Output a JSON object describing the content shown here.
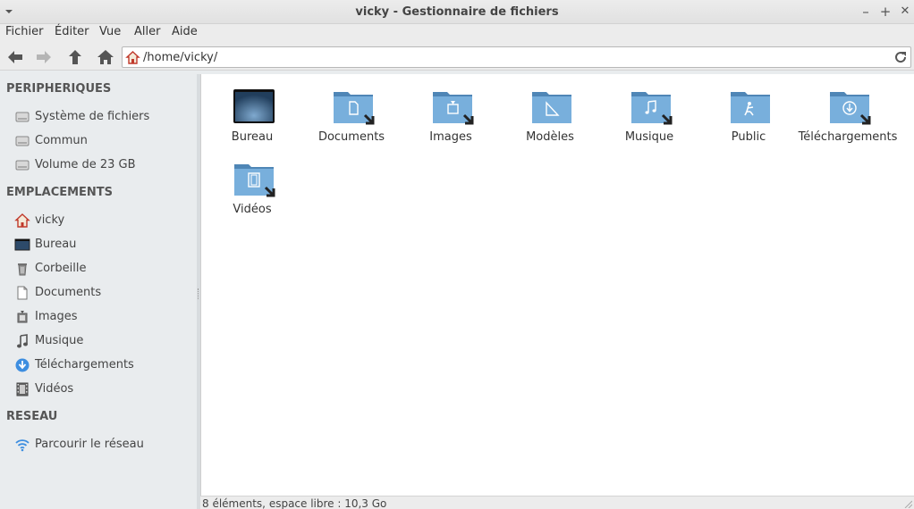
{
  "window": {
    "title": "vicky - Gestionnaire de fichiers",
    "minimize": "–",
    "maximize": "+",
    "close": "✕"
  },
  "menubar": [
    "Fichier",
    "Éditer",
    "Vue",
    "Aller",
    "Aide"
  ],
  "toolbar": {
    "icons": [
      "back-arrow-icon",
      "forward-arrow-icon",
      "up-arrow-icon",
      "home-icon"
    ],
    "location": "/home/vicky/"
  },
  "sidebar": {
    "devices_title": "PERIPHERIQUES",
    "devices": [
      {
        "label": "Système de fichiers",
        "icon": "drive-icon"
      },
      {
        "label": "Commun",
        "icon": "drive-icon"
      },
      {
        "label": "Volume de 23 GB",
        "icon": "drive-icon"
      }
    ],
    "places_title": "EMPLACEMENTS",
    "places": [
      {
        "label": "vicky",
        "icon": "home-icon"
      },
      {
        "label": "Bureau",
        "icon": "desktop-icon"
      },
      {
        "label": "Corbeille",
        "icon": "trash-icon"
      },
      {
        "label": "Documents",
        "icon": "document-icon"
      },
      {
        "label": "Images",
        "icon": "image-icon"
      },
      {
        "label": "Musique",
        "icon": "music-icon"
      },
      {
        "label": "Téléchargements",
        "icon": "download-icon"
      },
      {
        "label": "Vidéos",
        "icon": "video-icon"
      }
    ],
    "network_title": "RESEAU",
    "network": [
      {
        "label": "Parcourir le réseau",
        "icon": "wifi-icon"
      }
    ]
  },
  "files": [
    {
      "label": "Bureau",
      "icon": "desktop-folder-icon"
    },
    {
      "label": "Documents",
      "icon": "documents-folder-icon"
    },
    {
      "label": "Images",
      "icon": "images-folder-icon"
    },
    {
      "label": "Modèles",
      "icon": "templates-folder-icon"
    },
    {
      "label": "Musique",
      "icon": "music-folder-icon"
    },
    {
      "label": "Public",
      "icon": "public-folder-icon"
    },
    {
      "label": "Téléchargements",
      "icon": "downloads-folder-icon"
    },
    {
      "label": "Vidéos",
      "icon": "videos-folder-icon"
    }
  ],
  "status": "8 éléments, espace libre : 10,3 Go",
  "colors": {
    "folder": "#6fa8d6",
    "folder_dark": "#4f86b6",
    "accent": "#3d8ee0"
  }
}
